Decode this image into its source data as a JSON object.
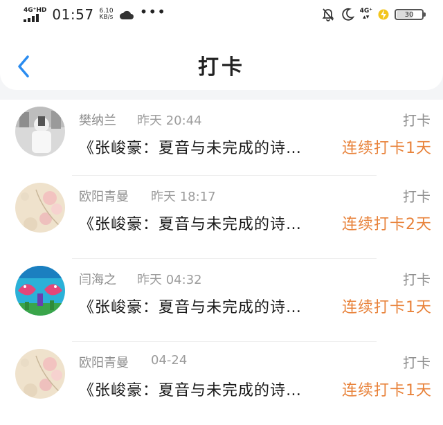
{
  "status_bar": {
    "network_label": "4G⁺HD",
    "time": "01:57",
    "speed_value": "6.10",
    "speed_unit": "KB/s",
    "more": "•••",
    "network_label_right": "4G⁺",
    "battery_level": "30",
    "icons": [
      "signal-icon",
      "cloud-icon",
      "mute-icon",
      "moon-icon",
      "signal-4g-icon",
      "charging-icon",
      "battery-icon"
    ]
  },
  "header": {
    "title": "打卡",
    "back_icon": "chevron-left-icon"
  },
  "colors": {
    "accent_back": "#2a8cf0",
    "streak": "#e8823a",
    "meta_gray": "#8e8e8e"
  },
  "items": [
    {
      "name": "樊纳兰",
      "time": "昨天 20:44",
      "tag": "打卡",
      "book": "《张峻豪：夏音与未完成的诗…",
      "streak": "连续打卡1天"
    },
    {
      "name": "欧阳青曼",
      "time": "昨天 18:17",
      "tag": "打卡",
      "book": "《张峻豪：夏音与未完成的诗…",
      "streak": "连续打卡2天"
    },
    {
      "name": "闫海之",
      "time": "昨天 04:32",
      "tag": "打卡",
      "book": "《张峻豪：夏音与未完成的诗…",
      "streak": "连续打卡1天"
    },
    {
      "name": "欧阳青曼",
      "time": "04-24",
      "tag": "打卡",
      "book": "《张峻豪：夏音与未完成的诗…",
      "streak": "连续打卡1天"
    }
  ]
}
